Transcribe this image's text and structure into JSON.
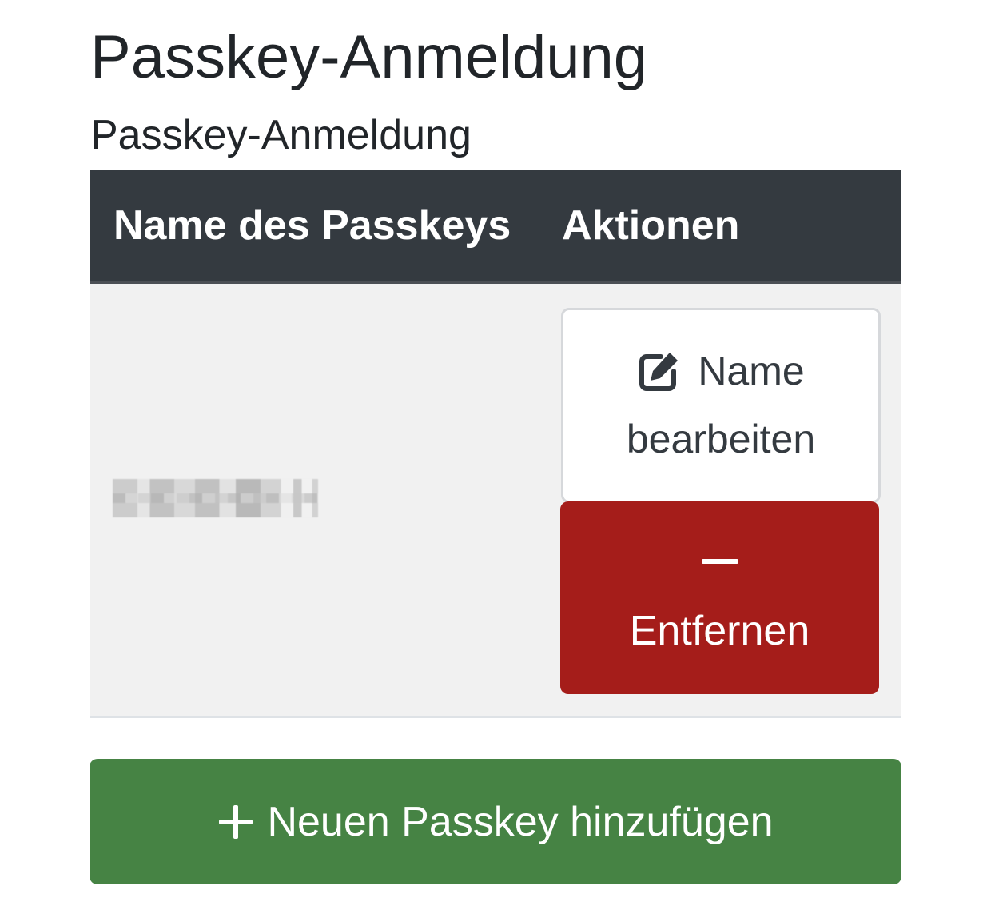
{
  "page": {
    "title": "Passkey-Anmeldung",
    "section_title": "Passkey-Anmeldung"
  },
  "table": {
    "columns": [
      "Name des Passkeys",
      "Aktionen"
    ],
    "rows": [
      {
        "name": "",
        "actions": {
          "rename_line1": "Name",
          "rename_line2": "bearbeiten",
          "remove_label": "Entfernen"
        }
      }
    ]
  },
  "add_button": {
    "label": "Neuen Passkey hinzufügen"
  },
  "icons": {
    "rename": "edit-icon",
    "remove": "minus-icon",
    "add": "plus-icon"
  },
  "colors": {
    "header_bg": "#343a40",
    "remove_bg": "#a51d1a",
    "add_bg": "#468344",
    "row_bg": "#f1f1f1"
  }
}
